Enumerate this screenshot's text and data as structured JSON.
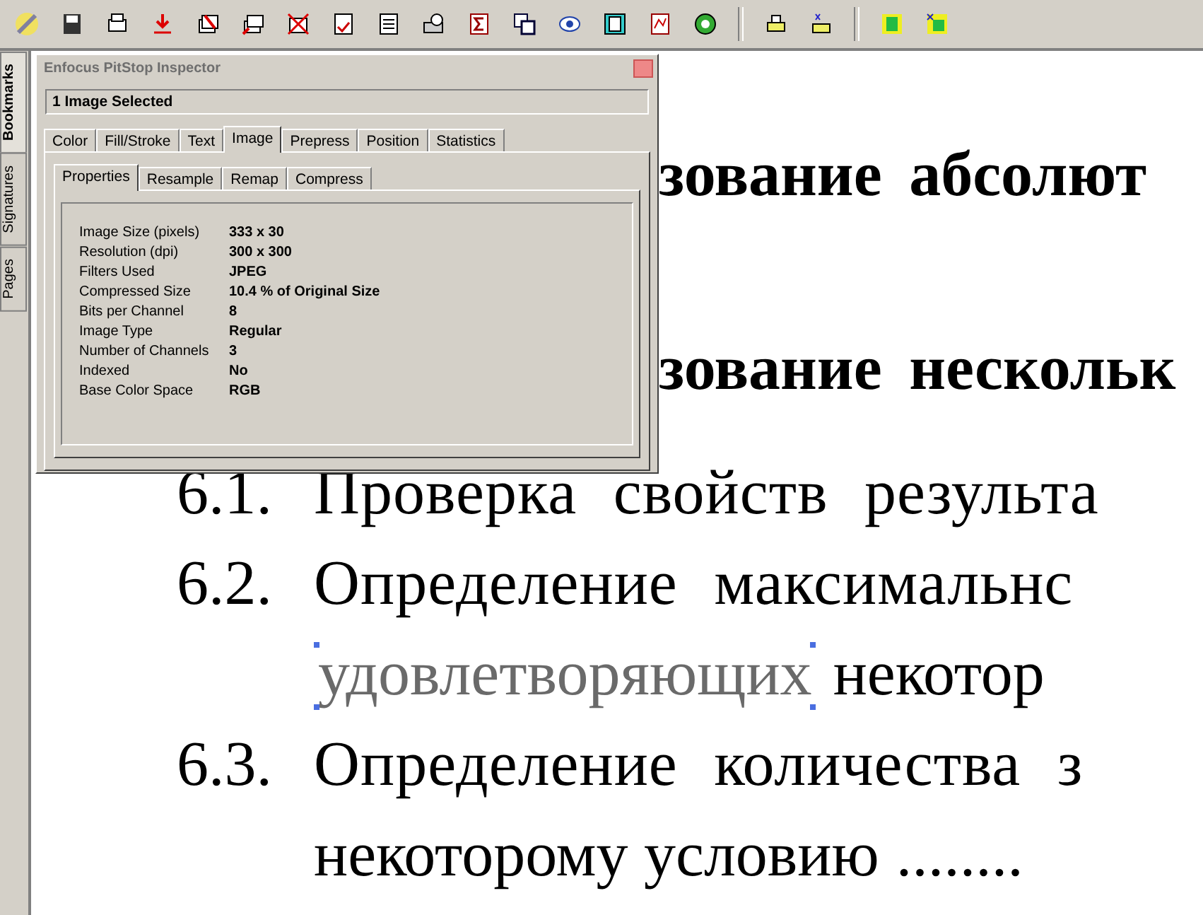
{
  "side_tabs": [
    {
      "label": "Bookmarks",
      "selected": true
    },
    {
      "label": "Signatures",
      "selected": false
    },
    {
      "label": "Pages",
      "selected": false
    }
  ],
  "inspector": {
    "title": "Enfocus PitStop Inspector",
    "selection": "1 Image Selected",
    "tabs": [
      {
        "label": "Color",
        "selected": false
      },
      {
        "label": "Fill/Stroke",
        "selected": false
      },
      {
        "label": "Text",
        "selected": false
      },
      {
        "label": "Image",
        "selected": true
      },
      {
        "label": "Prepress",
        "selected": false
      },
      {
        "label": "Position",
        "selected": false
      },
      {
        "label": "Statistics",
        "selected": false
      }
    ],
    "subtabs": [
      {
        "label": "Properties",
        "selected": true
      },
      {
        "label": "Resample",
        "selected": false
      },
      {
        "label": "Remap",
        "selected": false
      },
      {
        "label": "Compress",
        "selected": false
      }
    ],
    "properties": [
      {
        "label": "Image Size (pixels)",
        "value": "333 x 30"
      },
      {
        "label": "Resolution (dpi)",
        "value": "300 x 300"
      },
      {
        "label": "Filters Used",
        "value": "JPEG"
      },
      {
        "label": "Compressed Size",
        "value": "10.4 % of Original Size"
      },
      {
        "label": "Bits per Channel",
        "value": "8"
      },
      {
        "label": "Image Type",
        "value": "Regular"
      },
      {
        "label": "Number of Channels",
        "value": "3"
      },
      {
        "label": "Indexed",
        "value": "No"
      },
      {
        "label": "Base Color Space",
        "value": "RGB"
      }
    ]
  },
  "document": {
    "headings": [
      "зование абсолют",
      "зование нескольк"
    ],
    "items": [
      {
        "number": "6.1.",
        "text": "Проверка свойств результа"
      },
      {
        "number": "6.2.",
        "text": "Определение максимальнс",
        "continuation": [
          {
            "text": "удовлетворяющих",
            "selected": true
          },
          {
            "text": "некотор",
            "selected": false
          }
        ]
      },
      {
        "number": "6.3.",
        "text": "Определение количества з",
        "continuation": [
          {
            "text": "некоторому условию",
            "selected": false
          },
          {
            "text": "........",
            "selected": false
          }
        ]
      }
    ]
  }
}
